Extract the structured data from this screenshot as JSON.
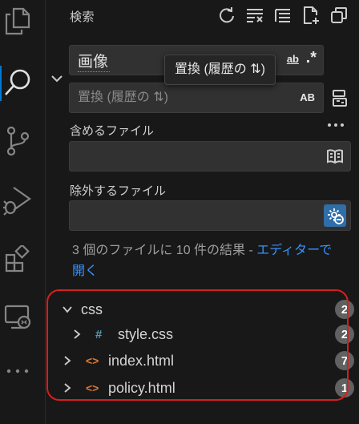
{
  "header": {
    "title": "検索"
  },
  "search": {
    "query": "画像",
    "match_word_label": "ab",
    "regex_label": ".*"
  },
  "replace": {
    "placeholder": "置換 (履歴の ⇅)",
    "preserve_case_label": "AB"
  },
  "tooltip": {
    "text": "置換 (履歴の ⇅)"
  },
  "include": {
    "label": "含めるファイル",
    "value": ""
  },
  "exclude": {
    "label": "除外するファイル",
    "value": ""
  },
  "results": {
    "summary_text": "3 個のファイルに 10 件の結果 - ",
    "open_in_editor_label": "エディターで開く",
    "tree": [
      {
        "name": "css",
        "type": "folder",
        "count": "2"
      },
      {
        "name": "style.css",
        "type": "css-file",
        "icon_glyph": "#",
        "count": "2"
      },
      {
        "name": "index.html",
        "type": "html-file",
        "icon_glyph": "<>",
        "count": "7"
      },
      {
        "name": "policy.html",
        "type": "html-file",
        "icon_glyph": "<>",
        "count": "1"
      }
    ]
  },
  "colors": {
    "accent": "#0078d4",
    "link": "#3794ff",
    "css_icon": "#519aba",
    "html_icon": "#e37933",
    "badge": "#616161",
    "highlight_border": "#d81e1e"
  }
}
